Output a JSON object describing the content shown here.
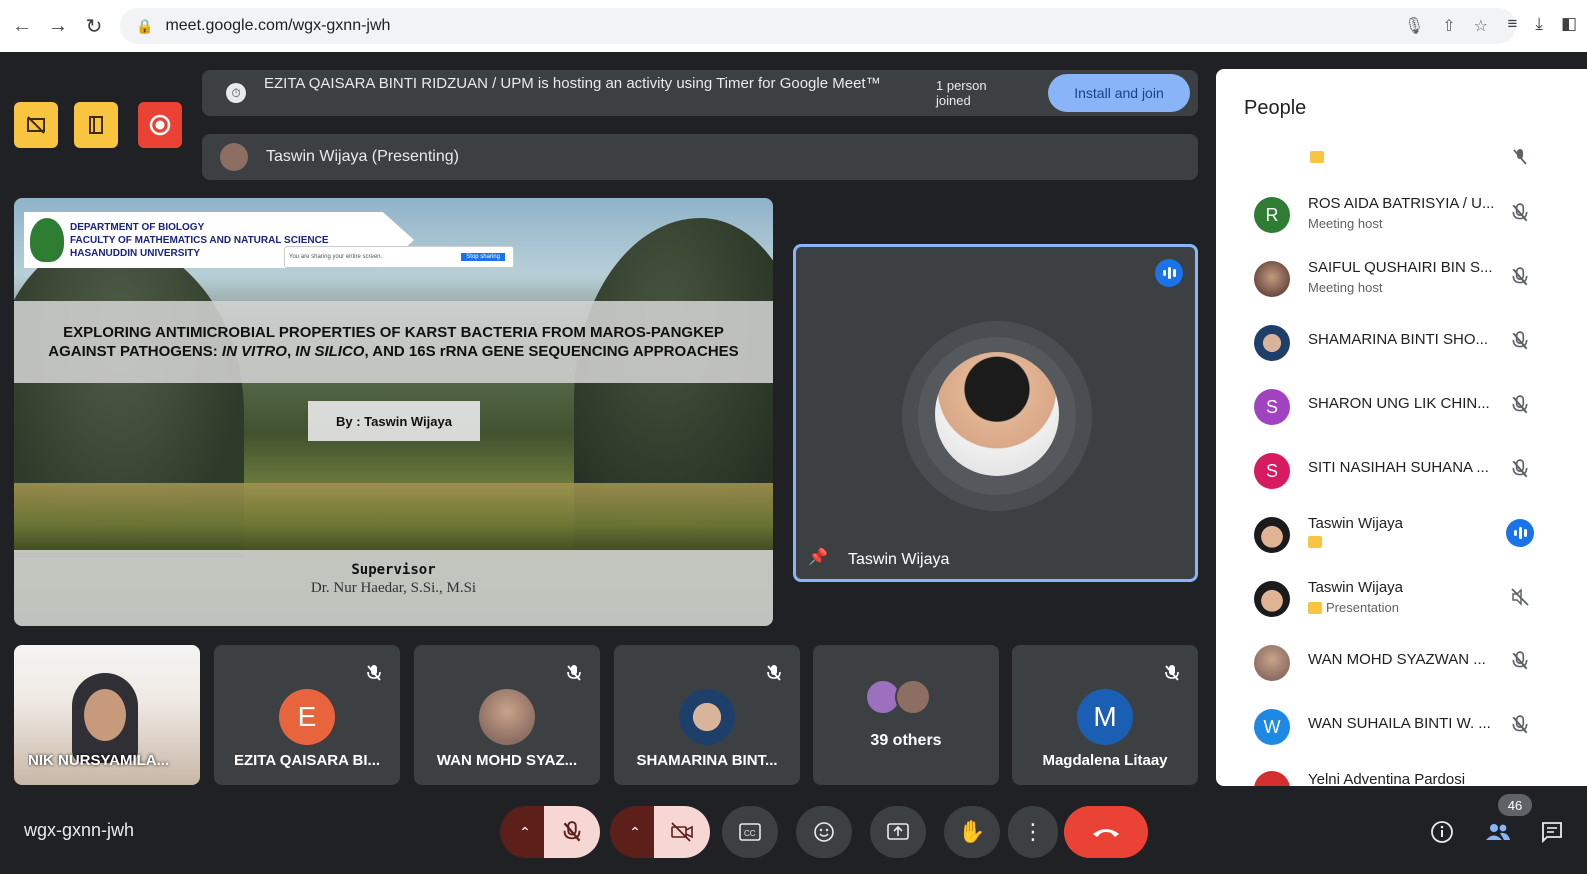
{
  "browser": {
    "url": "meet.google.com/wgx-gxnn-jwh"
  },
  "banner": {
    "text": "EZITA QAISARA BINTI RIDZUAN / UPM is hosting an activity using Timer for Google Meet™",
    "joined": "1 person joined",
    "install_label": "Install and join"
  },
  "presenting": {
    "label": "Taswin Wijaya (Presenting)"
  },
  "slide": {
    "dept_line1": "DEPARTMENT OF BIOLOGY",
    "dept_line2": "FACULTY OF MATHEMATICS AND NATURAL SCIENCE",
    "dept_line3": "HASANUDDIN UNIVERSITY",
    "share_notice": "You are sharing your entire screen.",
    "share_stop": "Stop sharing",
    "title_part1": "EXPLORING ANTIMICROBIAL PROPERTIES OF KARST BACTERIA FROM MAROS-PANGKEP AGAINST PATHOGENS: ",
    "title_italic1": "IN VITRO",
    "title_sep": ", ",
    "title_italic2": "IN SILICO",
    "title_part2": ", AND 16S rRNA GENE SEQUENCING APPROACHES",
    "by": "By : Taswin Wijaya",
    "supervisor_label": "Supervisor",
    "supervisor_name": "Dr. Nur Haedar, S.Si., M.Si"
  },
  "speaker": {
    "name": "Taswin Wijaya"
  },
  "tiles": [
    {
      "name": "NIK NURSYAMILA..."
    },
    {
      "initial": "E",
      "name": "EZITA QAISARA BI...",
      "color": "#e8643c"
    },
    {
      "name": "WAN MOHD SYAZ..."
    },
    {
      "name": "SHAMARINA BINT..."
    },
    {
      "name": "39 others"
    },
    {
      "initial": "M",
      "name": "Magdalena Litaay",
      "color": "#1a5fb4"
    }
  ],
  "people": {
    "title": "People",
    "list": [
      {
        "initial": "R",
        "name": "ROS AIDA BATRISYIA / U...",
        "role": "Meeting host",
        "color": "#2e7d32"
      },
      {
        "name": "SAIFUL QUSHAIRI BIN S...",
        "role": "Meeting host"
      },
      {
        "name": "SHAMARINA BINTI SHO..."
      },
      {
        "initial": "S",
        "name": "SHARON UNG LIK CHIN...",
        "color": "#a142c0"
      },
      {
        "initial": "S",
        "name": "SITI NASIHAH SUHANA ...",
        "color": "#d81b60"
      },
      {
        "name": "Taswin Wijaya"
      },
      {
        "name": "Taswin Wijaya",
        "role": "Presentation"
      },
      {
        "name": "WAN MOHD SYAZWAN ..."
      },
      {
        "initial": "W",
        "name": "WAN SUHAILA BINTI W. ...",
        "color": "#1e88e5"
      },
      {
        "name": "Yelni Adventina Pardosi"
      }
    ]
  },
  "bottom": {
    "meeting_code": "wgx-gxnn-jwh",
    "people_count": "46"
  },
  "colors": {
    "accent_blue": "#8ab4f8",
    "hangup_red": "#ea4335",
    "dark_bg": "#202124"
  }
}
